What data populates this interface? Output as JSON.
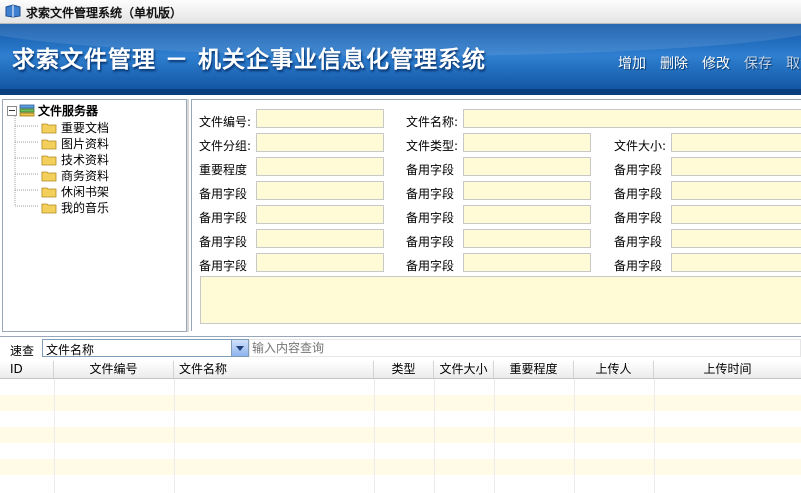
{
  "window": {
    "title": "求索文件管理系统（单机版）"
  },
  "banner": {
    "title": "求索文件管理 － 机关企事业信息化管理系统"
  },
  "toolbar": {
    "buttons": [
      {
        "label": "增加"
      },
      {
        "label": "删除"
      },
      {
        "label": "修改"
      },
      {
        "label": "保存"
      },
      {
        "label": "取消"
      }
    ]
  },
  "tree": {
    "root": "文件服务器",
    "items": [
      "重要文档",
      "图片资料",
      "技术资料",
      "商务资料",
      "休闲书架",
      "我的音乐"
    ]
  },
  "form": {
    "file_no": "文件编号:",
    "file_name": "文件名称:",
    "file_group": "文件分组:",
    "file_type": "文件类型:",
    "file_size": "文件大小:",
    "importance": "重要程度",
    "spare": "备用字段"
  },
  "search": {
    "label": "速查",
    "field": "文件名称",
    "placeholder": "输入内容查询"
  },
  "grid": {
    "columns": [
      "ID",
      "文件编号",
      "文件名称",
      "类型",
      "文件大小",
      "重要程度",
      "上传人",
      "上传时间"
    ],
    "row_stripe_color": "#fffbe6"
  },
  "colors": {
    "banner": "#1a63b3",
    "input_bg": "#fffbd6"
  }
}
